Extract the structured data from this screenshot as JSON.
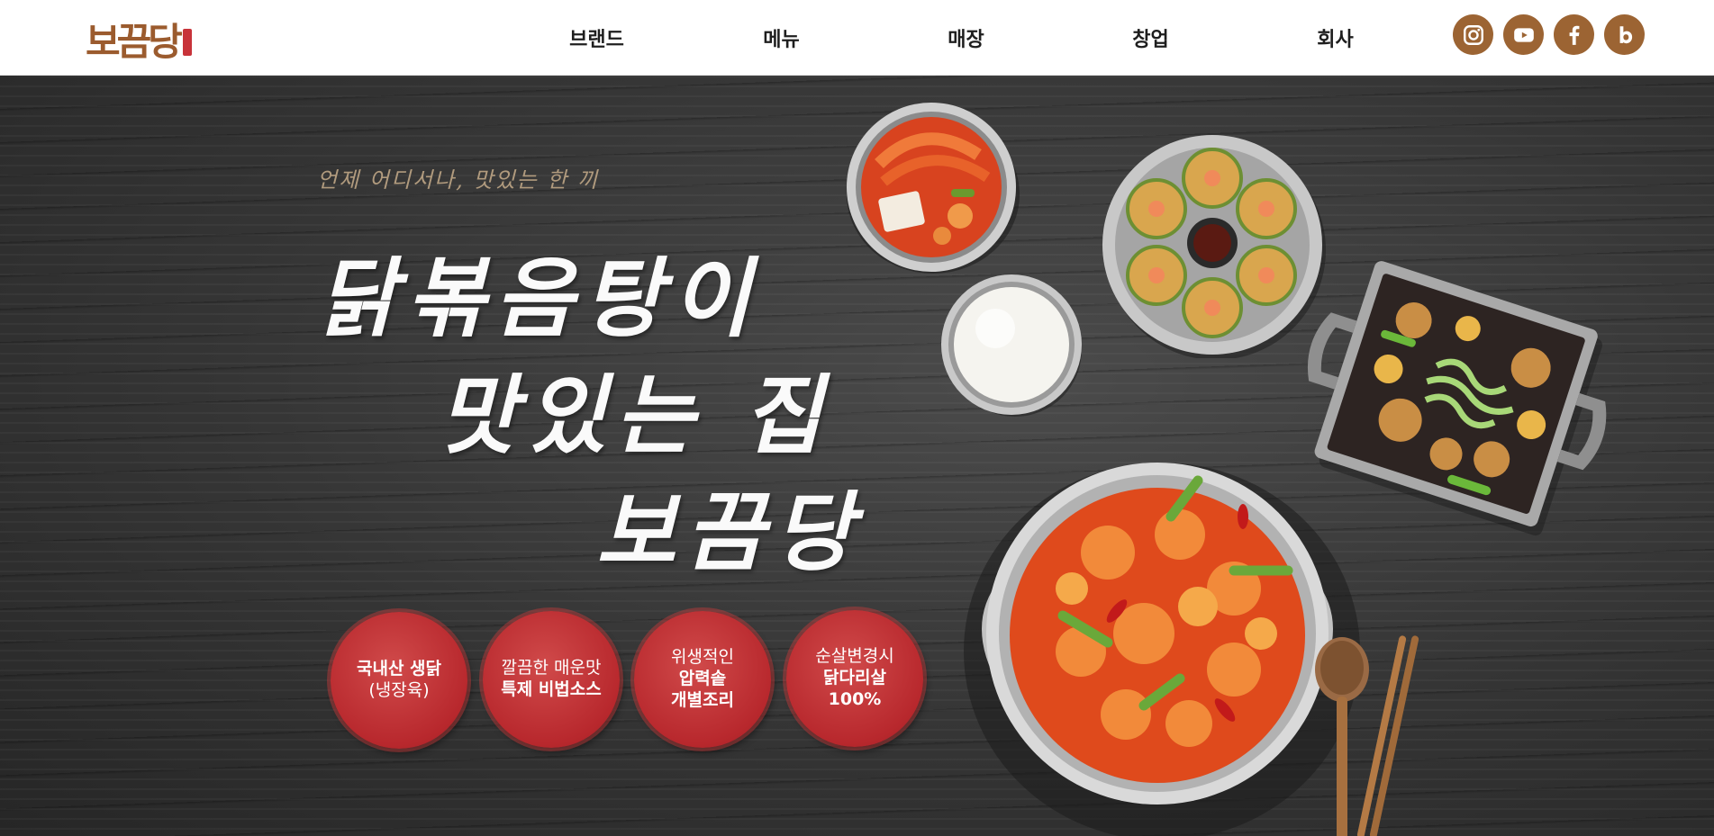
{
  "header": {
    "logo_text": "보끔당",
    "nav": [
      {
        "label": "브랜드"
      },
      {
        "label": "메뉴"
      },
      {
        "label": "매장"
      },
      {
        "label": "창업"
      },
      {
        "label": "회사"
      }
    ],
    "social": [
      {
        "icon": "instagram-icon"
      },
      {
        "icon": "youtube-icon"
      },
      {
        "icon": "facebook-icon"
      },
      {
        "icon": "blog-icon"
      }
    ],
    "accent_color": "#9c6433"
  },
  "hero": {
    "tagline": "언제 어디서나, 맛있는 한 끼",
    "title_lines": [
      "닭볶음탕이",
      "맛있는 집",
      "보끔당"
    ],
    "badges": [
      {
        "line1": "국내산 생닭",
        "line2": "(냉장육)",
        "line3": ""
      },
      {
        "line1": "깔끔한 매운맛",
        "line2": "특제 비법소스",
        "line3": ""
      },
      {
        "line1": "위생적인",
        "line2": "압력솥",
        "line3": "개별조리"
      },
      {
        "line1": "순살변경시",
        "line2": "닭다리살",
        "line3": "100%"
      }
    ],
    "badge_color": "#b8282d"
  }
}
